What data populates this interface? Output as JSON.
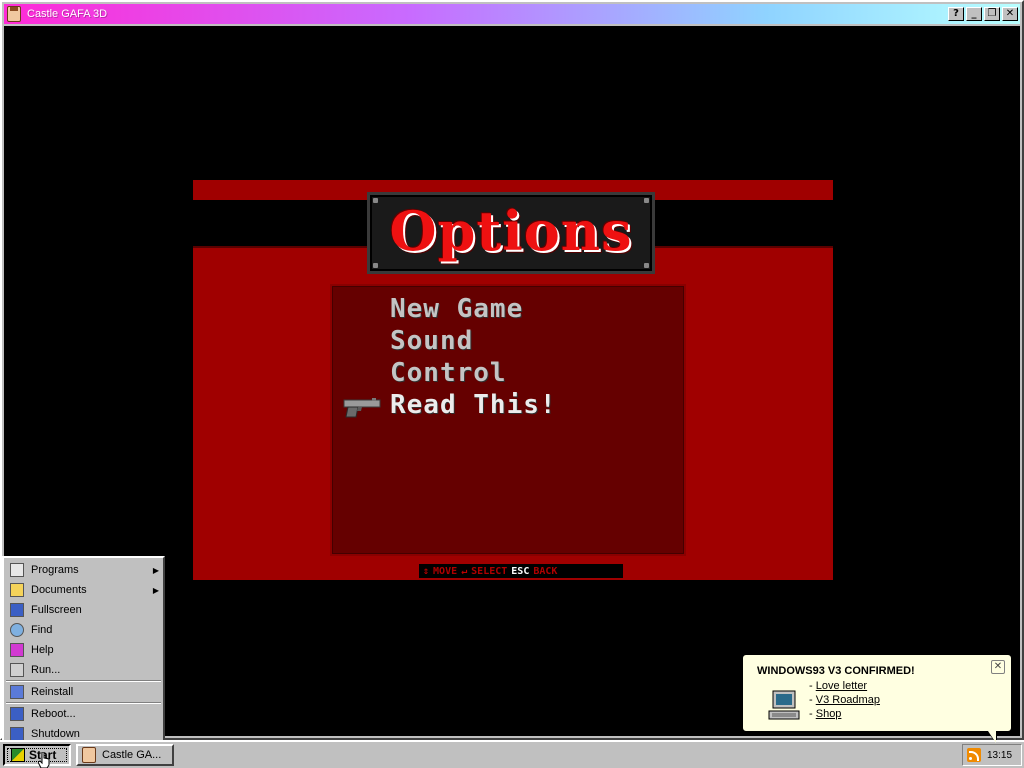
{
  "window": {
    "title": "Castle GAFA 3D",
    "buttons": {
      "help": "?",
      "minimize": "_",
      "restore": "❐",
      "close": "✕"
    }
  },
  "game": {
    "screen_title": "Options",
    "menu": {
      "items": [
        "New Game",
        "Sound",
        "Control",
        "Read This!"
      ],
      "selected_index": 3,
      "cursor_icon": "pistol-icon"
    },
    "hint_bar": {
      "move_icon": "⇕",
      "move": "MOVE",
      "select_icon": "↵",
      "select": "SELECT",
      "esc_key": "ESC",
      "back": "BACK"
    },
    "colors": {
      "background": "#a00000",
      "panel": "#650000",
      "title": "#ee1111"
    }
  },
  "start_menu": {
    "items": [
      {
        "label": "Programs",
        "icon": "programs-icon",
        "submenu": true
      },
      {
        "label": "Documents",
        "icon": "documents-folder-icon",
        "submenu": true
      },
      {
        "label": "Fullscreen",
        "icon": "fullscreen-icon",
        "submenu": false
      },
      {
        "label": "Find",
        "icon": "find-icon",
        "submenu": false
      },
      {
        "label": "Help",
        "icon": "help-book-icon",
        "submenu": false
      },
      {
        "label": "Run...",
        "icon": "run-icon",
        "submenu": false
      },
      {
        "label": "Reinstall",
        "icon": "reinstall-icon",
        "submenu": false
      },
      {
        "label": "Reboot...",
        "icon": "reboot-icon",
        "submenu": false
      },
      {
        "label": "Shutdown",
        "icon": "shutdown-icon",
        "submenu": false
      }
    ]
  },
  "notification": {
    "title": "WINDOWS93 V3 CONFIRMED!",
    "close": "✕",
    "links": [
      "Love letter",
      "V3 Roadmap",
      "Shop"
    ],
    "bullet": "-"
  },
  "taskbar": {
    "start_label": "Start",
    "tasks": [
      "Castle GA..."
    ],
    "clock": "13:15"
  }
}
